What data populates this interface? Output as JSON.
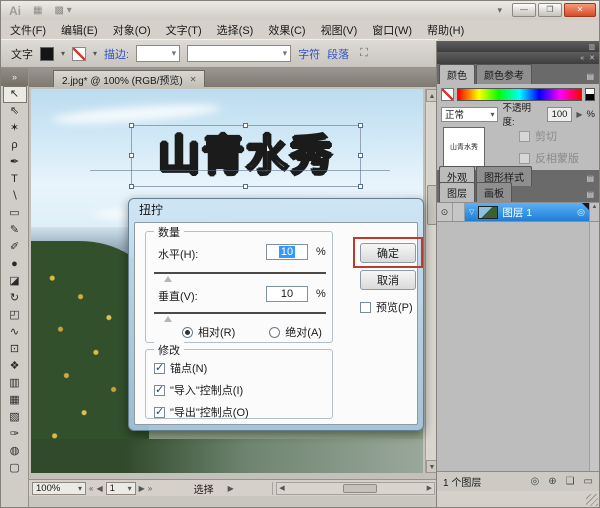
{
  "window": {
    "logo": "Ai",
    "bridge_icon": "▦",
    "workspace_icon": "▩",
    "workspace_arrow": "▾",
    "menu_arrow": "▾",
    "minimize": "—",
    "maximize": "❐",
    "close": "✕"
  },
  "menu": {
    "items": [
      "文件(F)",
      "编辑(E)",
      "对象(O)",
      "文字(T)",
      "选择(S)",
      "效果(C)",
      "视图(V)",
      "窗口(W)",
      "帮助(H)"
    ]
  },
  "control_bar": {
    "mode": "文字",
    "fill_arrow": "▾",
    "stroke_arrow": "▾",
    "stroke_label": "描边:",
    "spin_arrow": "▾",
    "font_arrow": "▾",
    "char_link": "字符",
    "para_link": "段落",
    "bucket_icon": "⛶"
  },
  "doc_tab": {
    "label": "2.jpg* @ 100% (RGB/预览)",
    "close": "✕"
  },
  "tool_head": "»",
  "tools": [
    {
      "name": "selection-tool",
      "glyph": "↖",
      "cls": "selected"
    },
    {
      "name": "direct-selection-tool",
      "glyph": "⇖"
    },
    {
      "name": "magic-wand-tool",
      "glyph": "✶"
    },
    {
      "name": "lasso-tool",
      "glyph": "ρ"
    },
    {
      "name": "pen-tool",
      "glyph": "✒"
    },
    {
      "name": "type-tool",
      "glyph": "T"
    },
    {
      "name": "line-segment-tool",
      "glyph": "∖"
    },
    {
      "name": "rectangle-tool",
      "glyph": "▭"
    },
    {
      "name": "paintbrush-tool",
      "glyph": "✎"
    },
    {
      "name": "pencil-tool",
      "glyph": "✐"
    },
    {
      "name": "blob-brush-tool",
      "glyph": "●"
    },
    {
      "name": "eraser-tool",
      "glyph": "◪"
    },
    {
      "name": "rotate-tool",
      "glyph": "↻"
    },
    {
      "name": "scale-tool",
      "glyph": "◰"
    },
    {
      "name": "width-tool",
      "glyph": "∿"
    },
    {
      "name": "free-transform-tool",
      "glyph": "⊡"
    },
    {
      "name": "symbol-sprayer-tool",
      "glyph": "❖"
    },
    {
      "name": "column-graph-tool",
      "glyph": "▥"
    },
    {
      "name": "mesh-tool",
      "glyph": "▦"
    },
    {
      "name": "gradient-tool",
      "glyph": "▧"
    },
    {
      "name": "eyedropper-tool",
      "glyph": "✑"
    },
    {
      "name": "blend-tool",
      "glyph": "◍"
    },
    {
      "name": "artboard-tool",
      "glyph": "▢"
    }
  ],
  "canvas": {
    "art_text": "山青水秀"
  },
  "dialog": {
    "title": "扭拧",
    "amount": {
      "legend": "数量",
      "h_label": "水平(H):",
      "h_value": "10",
      "v_label": "垂直(V):",
      "v_value": "10",
      "unit": "%",
      "relative": "相对(R)",
      "absolute": "绝对(A)"
    },
    "modify": {
      "legend": "修改",
      "checks": [
        "锚点(N)",
        "\"导入\"控制点(I)",
        "\"导出\"控制点(O)"
      ]
    },
    "ok": "确定",
    "cancel": "取消",
    "preview": "预览(P)"
  },
  "panels": {
    "dock_collapse": "«",
    "dock_close": "✕",
    "dock_grid": "▥",
    "panel_menu": "▤",
    "color": {
      "tab": "颜色",
      "guide_tab": "颜色参考"
    },
    "transparency": {
      "blend_mode": "正常",
      "select_arrow": "▾",
      "opacity_label": "不透明度:",
      "opacity_value": "100",
      "step_arrow": "▶",
      "unit": "%",
      "clip": "剪切",
      "invert": "反相蒙版",
      "thumb_text": "山青水秀"
    },
    "appearance": {
      "tab": "外观",
      "styles_tab": "图形样式"
    },
    "layers": {
      "tab": "图层",
      "artboards_tab": "画板",
      "eye_icon": "⊙",
      "expand_arrow": "▽",
      "target_icon": "◎",
      "scroll_up": "▲",
      "layer_name": "图层 1",
      "count": "1 个图层",
      "icons": [
        {
          "name": "make-clipping-mask-icon",
          "glyph": "◎"
        },
        {
          "name": "new-sublayer-icon",
          "glyph": "⊕"
        },
        {
          "name": "new-layer-icon",
          "glyph": "❏"
        },
        {
          "name": "delete-layer-icon",
          "glyph": "▭"
        }
      ]
    }
  },
  "status_bar": {
    "zoom": "100%",
    "zoom_arrow": "▾",
    "first": "«",
    "prev": "◀",
    "artboard": "1",
    "page_arrow": "▾",
    "next": "▶",
    "last": "»",
    "mode": "选择",
    "mode_arrow": "▶",
    "h_left": "◀",
    "h_right": "▶",
    "vs_up": "▲",
    "vs_down": "▼"
  }
}
